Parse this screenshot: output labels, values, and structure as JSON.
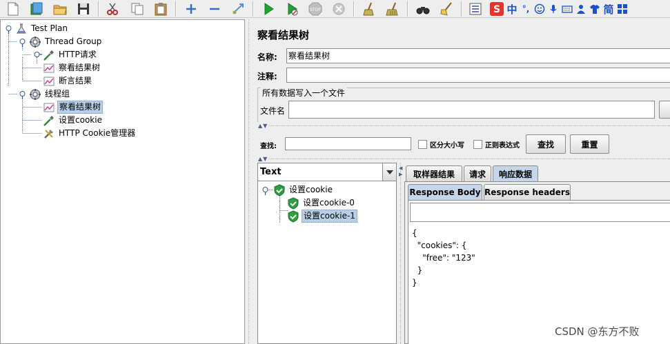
{
  "ime": {
    "lang": "中",
    "punct": "°,",
    "simplified": "简"
  },
  "tree": {
    "test_plan": "Test Plan",
    "thread_group": "Thread Group",
    "http_request": "HTTP请求",
    "view_results_tree_1": "察看结果树",
    "assertion_results": "断言结果",
    "thread_group_2": "线程组",
    "view_results_tree_2": "察看结果树",
    "set_cookie": "设置cookie",
    "cookie_manager": "HTTP Cookie管理器"
  },
  "panel": {
    "title": "察看结果树",
    "name_label": "名称:",
    "name_value": "察看结果树",
    "comment_label": "注释:",
    "comment_value": "",
    "file_group_title": "所有数据写入一个文件",
    "filename_label": "文件名",
    "filename_value": ""
  },
  "search": {
    "label": "查找:",
    "value": "",
    "case_sensitive": "区分大小写",
    "regex": "正则表达式",
    "find_button": "查找",
    "reset_button": "重置"
  },
  "results": {
    "renderer": "Text",
    "root": "设置cookie",
    "child_0": "设置cookie-0",
    "child_1": "设置cookie-1"
  },
  "tabs": {
    "sampler_result": "取样器结果",
    "request": "请求",
    "response_data": "响应数据",
    "response_body": "Response Body",
    "response_headers": "Response headers"
  },
  "response_text": "{\n  \"cookies\": {\n    \"free\": \"123\"\n  }\n}",
  "watermark": "CSDN @东方不败"
}
